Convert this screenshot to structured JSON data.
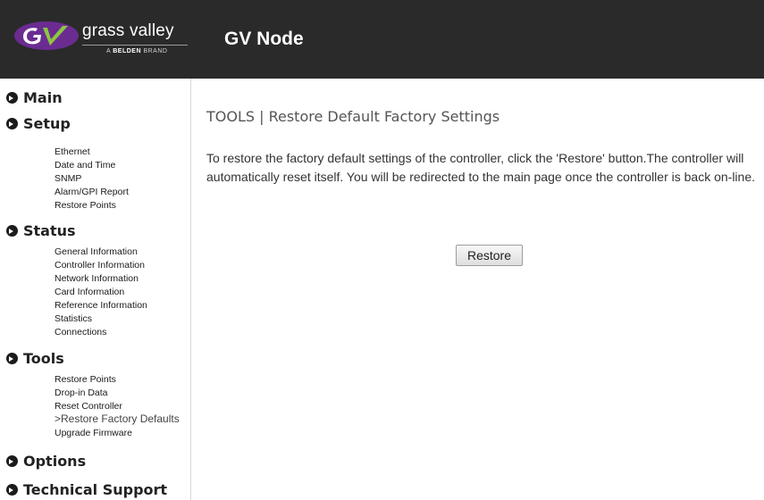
{
  "header": {
    "logo_text": "grass valley",
    "logo_brand_prefix": "A ",
    "logo_brand_bold": "BELDEN",
    "logo_brand_suffix": " BRAND",
    "app_title": "GV Node"
  },
  "sidebar": {
    "sections": [
      {
        "label": "Main",
        "items": []
      },
      {
        "label": "Setup",
        "items": [
          "Ethernet",
          "Date and Time",
          "SNMP",
          "Alarm/GPI Report",
          "Restore Points"
        ]
      },
      {
        "label": "Status",
        "items": [
          "General Information",
          "Controller Information",
          "Network Information",
          "Card Information",
          "Reference Information",
          "Statistics",
          "Connections"
        ]
      },
      {
        "label": "Tools",
        "items": [
          "Restore Points",
          "Drop-in Data",
          "Reset Controller",
          ">Restore Factory Defaults",
          "Upgrade Firmware"
        ]
      },
      {
        "label": "Options",
        "items": []
      },
      {
        "label": "Technical Support",
        "items": []
      }
    ]
  },
  "main": {
    "heading": "TOOLS | Restore Default Factory Settings",
    "description": "To restore the factory default settings of the controller, click the 'Restore' button.The controller will automatically reset itself. You will be redirected to the main page once the controller is back on-line.",
    "restore_button": "Restore"
  },
  "colors": {
    "header_bg": "#2a2a2a",
    "logo_purple": "#6b2c91",
    "logo_green": "#8dc63f"
  },
  "icons": {
    "section_bullet": "chevron-circle-right-icon",
    "logo": "grass-valley-gv-logo"
  }
}
